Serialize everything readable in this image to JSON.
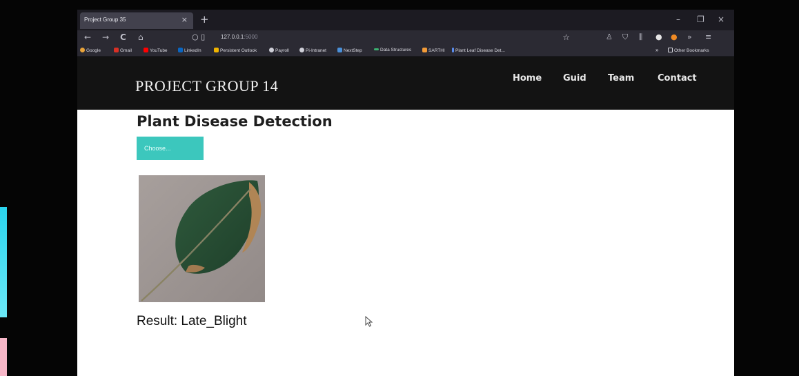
{
  "browser": {
    "tab_title": "Project Group 35",
    "tab_close": "×",
    "new_tab": "+",
    "window_controls": [
      "–",
      "❐",
      "×"
    ],
    "nav": {
      "back": "←",
      "forward": "→",
      "reload": "C",
      "home": "⌂"
    },
    "url_icons": "○ ▯",
    "url_host": "127.0.0.1",
    "url_port": ":5000",
    "star": "☆",
    "toolbar_icons": [
      "♙",
      "⛉",
      "⫼",
      "●",
      "●",
      "»",
      "≡"
    ],
    "bookmarks": [
      {
        "label": "Google",
        "color": "#e8a33a"
      },
      {
        "label": "Gmail",
        "color": "#d93025"
      },
      {
        "label": "YouTube",
        "color": "#ff0000"
      },
      {
        "label": "LinkedIn",
        "color": "#0a66c2"
      },
      {
        "label": "Persistent Outlook",
        "color": "#f0b400"
      },
      {
        "label": "Payroll",
        "color": "#cfcfd8"
      },
      {
        "label": "Pi-Intranet",
        "color": "#cfcfd8"
      },
      {
        "label": "NextStep",
        "color": "#4a90d9"
      },
      {
        "label": "Data Structures",
        "color": "#3cb371"
      },
      {
        "label": "SARTHI",
        "color": "#f29b38"
      },
      {
        "label": "Plant Leaf Disease Det...",
        "color": "#5b8def"
      }
    ],
    "bookmarks_more": "»",
    "other_bookmarks": "Other Bookmarks"
  },
  "site": {
    "brand": "PROJECT GROUP 14",
    "nav": [
      "Home",
      "Guid",
      "Team",
      "Contact"
    ]
  },
  "main": {
    "title": "Plant Disease Detection",
    "choose_label": "Choose...",
    "result_label": "Result:",
    "result_value": "Late_Blight"
  },
  "colors": {
    "accent": "#3cc7bd",
    "header_bg": "#131313"
  }
}
